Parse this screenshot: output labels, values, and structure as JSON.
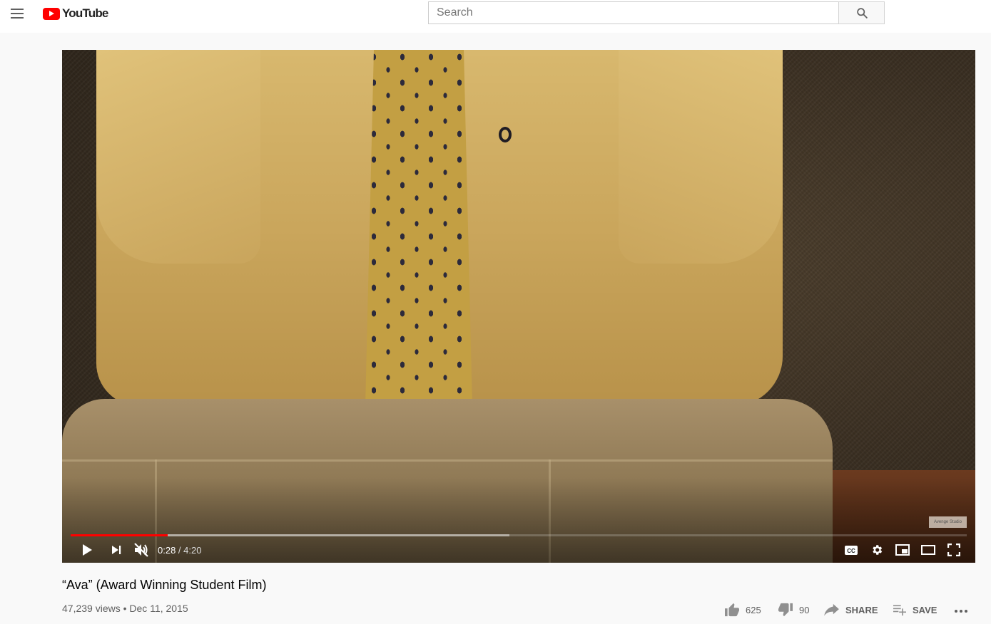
{
  "header": {
    "logo_text": "YouTube",
    "search_placeholder": "Search"
  },
  "player": {
    "watermark": "Avenge Studio",
    "time_current": "0:28",
    "time_separator": " / ",
    "time_duration": "4:20",
    "played_fraction": 0.1083,
    "buffered_fraction": 0.49,
    "muted": true
  },
  "video": {
    "title": "“Ava” (Award Winning Student Film)",
    "views": "47,239 views",
    "dot": " • ",
    "date": "Dec 11, 2015"
  },
  "actions": {
    "like_count": "625",
    "dislike_count": "90",
    "share_label": "SHARE",
    "save_label": "SAVE"
  },
  "colors": {
    "brand_red": "#ff0000",
    "text_secondary": "#606060"
  }
}
